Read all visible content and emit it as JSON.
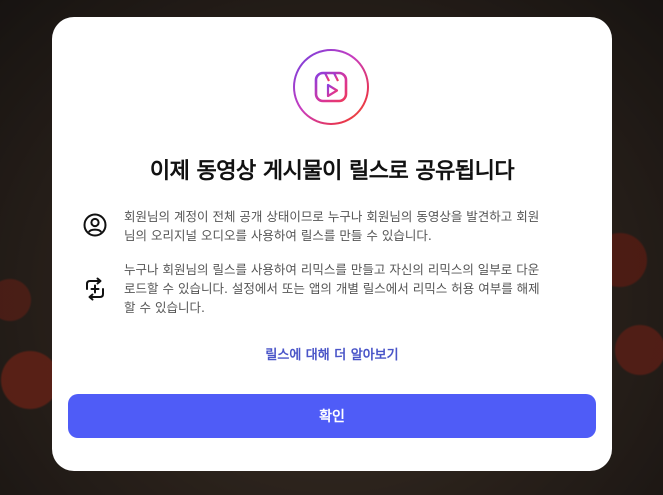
{
  "dialog": {
    "title": "이제 동영상 게시물이 릴스로 공유됩니다",
    "items": [
      {
        "icon": "user-circle-icon",
        "text": "회원님의 계정이 전체 공개 상태이므로 누구나 회원님의 동영상을 발견하고 회원님의 오리지널 오디오를 사용하여 릴스를 만들 수 있습니다."
      },
      {
        "icon": "remix-icon",
        "text": "누구나 회원님의 릴스를 사용하여 리믹스를 만들고 자신의 리믹스의 일부로 다운로드할 수 있습니다. 설정에서 또는 앱의 개별 릴스에서 리믹스 허용 여부를 해제할 수 있습니다."
      }
    ],
    "learn_more_link": "릴스에 대해 더 알아보기",
    "confirm_button": "확인",
    "logo_icon": "reels-icon"
  },
  "colors": {
    "accent": "#4f5cf7",
    "link": "#4a55c8",
    "logo_gradient": [
      "#6b3fe0",
      "#c83dbf",
      "#e8344f",
      "#f26b2a"
    ]
  }
}
